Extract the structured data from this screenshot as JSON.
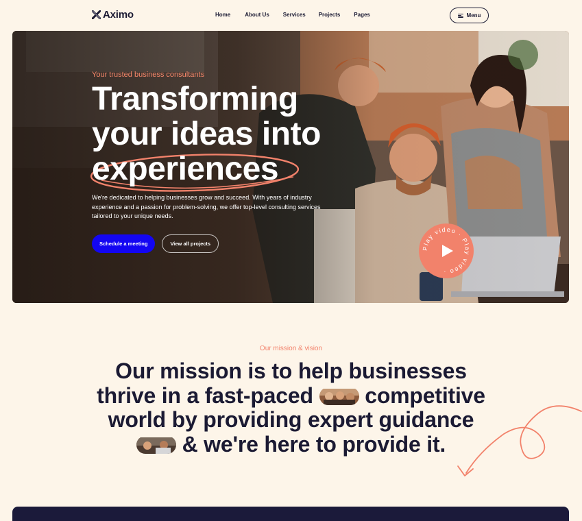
{
  "header": {
    "logo": "Aximo",
    "nav": [
      "Home",
      "About Us",
      "Services",
      "Projects",
      "Pages"
    ],
    "menu_label": "Menu"
  },
  "hero": {
    "eyebrow": "Your trusted business consultants",
    "title_line1": "Transforming",
    "title_line2": "your ideas into",
    "title_line3": "experiences",
    "description": "We're dedicated to helping businesses grow and succeed. With years of industry experience and a passion for problem-solving, we offer top-level consulting services tailored to your unique needs.",
    "primary_button": "Schedule a meeting",
    "secondary_button": "View all projects",
    "play_text": "Play video · Play video ·"
  },
  "mission": {
    "eyebrow": "Our mission & vision",
    "line1": "Our mission is to help businesses",
    "line2_a": "thrive in a fast-paced",
    "line2_b": "competitive",
    "line3": "world by providing expert guidance",
    "line4": "& we're here to provide it."
  },
  "colors": {
    "background": "#fdf5e9",
    "accent": "#f6876a",
    "primary_button": "#1306f2",
    "dark": "#1b1a33"
  },
  "icons": {
    "logo": "x-logo-icon",
    "menu": "hamburger-icon",
    "play": "play-icon"
  }
}
